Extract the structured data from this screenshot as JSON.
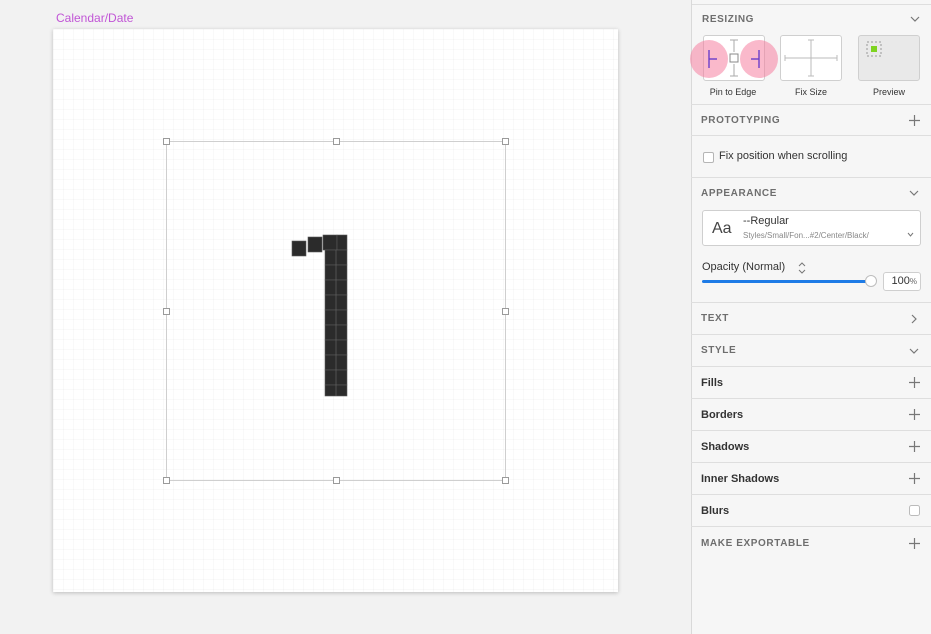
{
  "canvas": {
    "artboard_label": "Calendar/Date"
  },
  "inspector": {
    "resizing": {
      "title": "RESIZING",
      "pin_label": "Pin to Edge",
      "fix_label": "Fix Size",
      "preview_label": "Preview"
    },
    "prototyping": {
      "title": "PROTOTYPING",
      "fix_position_label": "Fix position when scrolling"
    },
    "appearance": {
      "title": "APPEARANCE",
      "text_style_preview": "Aa",
      "text_style_name": "--Regular",
      "text_style_path": "Styles/Small/Fon...#2/Center/Black/",
      "opacity_label": "Opacity (Normal)",
      "opacity_value": "100",
      "opacity_unit": "%",
      "opacity_fraction": 1.0
    },
    "sections": {
      "text": "TEXT",
      "style": "STYLE",
      "fills": "Fills",
      "borders": "Borders",
      "shadows": "Shadows",
      "inner_shadows": "Inner Shadows",
      "blurs": "Blurs",
      "make_exportable": "MAKE EXPORTABLE"
    }
  },
  "colors": {
    "accent": "#1e7be6",
    "artboard_label": "#c155d6",
    "pin_highlight": "#f680a0",
    "preview_dot": "#7ed321"
  }
}
